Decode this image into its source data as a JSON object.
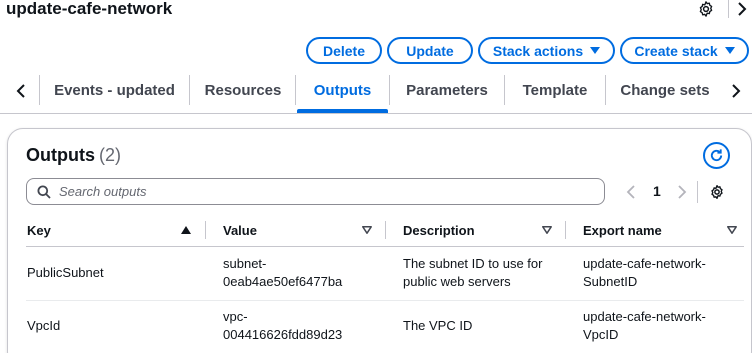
{
  "header": {
    "stack_name": "update-cafe-network"
  },
  "actions": {
    "delete_label": "Delete",
    "update_label": "Update",
    "stack_actions_label": "Stack actions",
    "create_stack_label": "Create stack"
  },
  "tabs": [
    {
      "label": "Events - updated",
      "active": false
    },
    {
      "label": "Resources",
      "active": false
    },
    {
      "label": "Outputs",
      "active": true
    },
    {
      "label": "Parameters",
      "active": false
    },
    {
      "label": "Template",
      "active": false
    },
    {
      "label": "Change sets",
      "active": false
    }
  ],
  "outputs": {
    "title": "Outputs",
    "count": "(2)",
    "search": {
      "placeholder": "Search outputs",
      "value": ""
    },
    "pagination": {
      "current_page": "1"
    },
    "columns": [
      "Key",
      "Value",
      "Description",
      "Export name"
    ],
    "rows": [
      {
        "key": "PublicSubnet",
        "value": "subnet-\n0eab4ae50ef6477ba",
        "description": "The subnet ID to use for\npublic web servers",
        "export_name": "update-cafe-network-\nSubnetID"
      },
      {
        "key": "VpcId",
        "value": "vpc-\n004416626fdd89d23",
        "description": "The VPC ID",
        "export_name": "update-cafe-network-\nVpcID"
      }
    ]
  },
  "colors": {
    "accent": "#006ce0",
    "text": "#0f141a",
    "tab_inactive": "#424650",
    "border": "#c6c6cd"
  },
  "icons": {
    "header_settings": "gear-icon",
    "header_collapse": "chevron-right-icon",
    "tab_scroll_left": "chevron-left-icon",
    "tab_scroll_right": "chevron-right-icon",
    "refresh": "refresh-icon",
    "search": "search-icon",
    "prev_page": "chevron-left-icon",
    "next_page": "chevron-right-icon",
    "preferences": "gear-icon",
    "sort_ascending": "caret-up-icon",
    "sort_none": "caret-down-icon"
  }
}
